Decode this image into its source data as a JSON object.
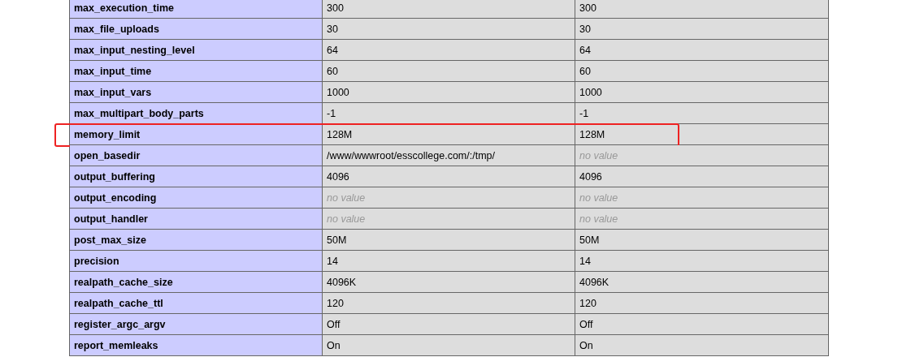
{
  "rows": [
    {
      "directive": "max_execution_time",
      "local": {
        "text": "300",
        "kind": "plain"
      },
      "master": {
        "text": "300",
        "kind": "plain"
      },
      "highlighted": false
    },
    {
      "directive": "max_file_uploads",
      "local": {
        "text": "30",
        "kind": "plain"
      },
      "master": {
        "text": "30",
        "kind": "plain"
      },
      "highlighted": false
    },
    {
      "directive": "max_input_nesting_level",
      "local": {
        "text": "64",
        "kind": "plain"
      },
      "master": {
        "text": "64",
        "kind": "plain"
      },
      "highlighted": false
    },
    {
      "directive": "max_input_time",
      "local": {
        "text": "60",
        "kind": "plain"
      },
      "master": {
        "text": "60",
        "kind": "plain"
      },
      "highlighted": false
    },
    {
      "directive": "max_input_vars",
      "local": {
        "text": "1000",
        "kind": "plain"
      },
      "master": {
        "text": "1000",
        "kind": "plain"
      },
      "highlighted": false
    },
    {
      "directive": "max_multipart_body_parts",
      "local": {
        "text": "-1",
        "kind": "plain"
      },
      "master": {
        "text": "-1",
        "kind": "plain"
      },
      "highlighted": false
    },
    {
      "directive": "memory_limit",
      "local": {
        "text": "128M",
        "kind": "plain"
      },
      "master": {
        "text": "128M",
        "kind": "plain"
      },
      "highlighted": true
    },
    {
      "directive": "open_basedir",
      "local": {
        "text": "/www/wwwroot/esscollege.com/:/tmp/",
        "kind": "plain"
      },
      "master": {
        "text": "no value",
        "kind": "no_value"
      },
      "highlighted": false
    },
    {
      "directive": "output_buffering",
      "local": {
        "text": "4096",
        "kind": "plain"
      },
      "master": {
        "text": "4096",
        "kind": "plain"
      },
      "highlighted": false
    },
    {
      "directive": "output_encoding",
      "local": {
        "text": "no value",
        "kind": "no_value"
      },
      "master": {
        "text": "no value",
        "kind": "no_value"
      },
      "highlighted": false
    },
    {
      "directive": "output_handler",
      "local": {
        "text": "no value",
        "kind": "no_value"
      },
      "master": {
        "text": "no value",
        "kind": "no_value"
      },
      "highlighted": false
    },
    {
      "directive": "post_max_size",
      "local": {
        "text": "50M",
        "kind": "plain"
      },
      "master": {
        "text": "50M",
        "kind": "plain"
      },
      "highlighted": false
    },
    {
      "directive": "precision",
      "local": {
        "text": "14",
        "kind": "plain"
      },
      "master": {
        "text": "14",
        "kind": "plain"
      },
      "highlighted": false
    },
    {
      "directive": "realpath_cache_size",
      "local": {
        "text": "4096K",
        "kind": "plain"
      },
      "master": {
        "text": "4096K",
        "kind": "plain"
      },
      "highlighted": false
    },
    {
      "directive": "realpath_cache_ttl",
      "local": {
        "text": "120",
        "kind": "plain"
      },
      "master": {
        "text": "120",
        "kind": "plain"
      },
      "highlighted": false
    },
    {
      "directive": "register_argc_argv",
      "local": {
        "text": "Off",
        "kind": "plain"
      },
      "master": {
        "text": "Off",
        "kind": "plain"
      },
      "highlighted": false
    },
    {
      "directive": "report_memleaks",
      "local": {
        "text": "On",
        "kind": "plain"
      },
      "master": {
        "text": "On",
        "kind": "plain"
      },
      "highlighted": false
    }
  ]
}
